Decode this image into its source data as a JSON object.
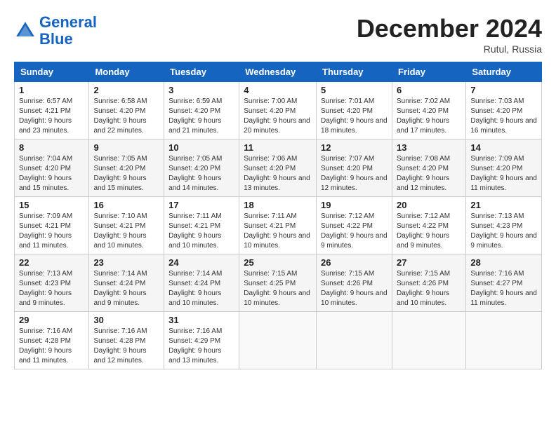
{
  "header": {
    "logo_line1": "General",
    "logo_line2": "Blue",
    "month": "December 2024",
    "location": "Rutul, Russia"
  },
  "weekdays": [
    "Sunday",
    "Monday",
    "Tuesday",
    "Wednesday",
    "Thursday",
    "Friday",
    "Saturday"
  ],
  "weeks": [
    [
      {
        "day": "1",
        "sunrise": "Sunrise: 6:57 AM",
        "sunset": "Sunset: 4:21 PM",
        "daylight": "Daylight: 9 hours and 23 minutes."
      },
      {
        "day": "2",
        "sunrise": "Sunrise: 6:58 AM",
        "sunset": "Sunset: 4:20 PM",
        "daylight": "Daylight: 9 hours and 22 minutes."
      },
      {
        "day": "3",
        "sunrise": "Sunrise: 6:59 AM",
        "sunset": "Sunset: 4:20 PM",
        "daylight": "Daylight: 9 hours and 21 minutes."
      },
      {
        "day": "4",
        "sunrise": "Sunrise: 7:00 AM",
        "sunset": "Sunset: 4:20 PM",
        "daylight": "Daylight: 9 hours and 20 minutes."
      },
      {
        "day": "5",
        "sunrise": "Sunrise: 7:01 AM",
        "sunset": "Sunset: 4:20 PM",
        "daylight": "Daylight: 9 hours and 18 minutes."
      },
      {
        "day": "6",
        "sunrise": "Sunrise: 7:02 AM",
        "sunset": "Sunset: 4:20 PM",
        "daylight": "Daylight: 9 hours and 17 minutes."
      },
      {
        "day": "7",
        "sunrise": "Sunrise: 7:03 AM",
        "sunset": "Sunset: 4:20 PM",
        "daylight": "Daylight: 9 hours and 16 minutes."
      }
    ],
    [
      {
        "day": "8",
        "sunrise": "Sunrise: 7:04 AM",
        "sunset": "Sunset: 4:20 PM",
        "daylight": "Daylight: 9 hours and 15 minutes."
      },
      {
        "day": "9",
        "sunrise": "Sunrise: 7:05 AM",
        "sunset": "Sunset: 4:20 PM",
        "daylight": "Daylight: 9 hours and 15 minutes."
      },
      {
        "day": "10",
        "sunrise": "Sunrise: 7:05 AM",
        "sunset": "Sunset: 4:20 PM",
        "daylight": "Daylight: 9 hours and 14 minutes."
      },
      {
        "day": "11",
        "sunrise": "Sunrise: 7:06 AM",
        "sunset": "Sunset: 4:20 PM",
        "daylight": "Daylight: 9 hours and 13 minutes."
      },
      {
        "day": "12",
        "sunrise": "Sunrise: 7:07 AM",
        "sunset": "Sunset: 4:20 PM",
        "daylight": "Daylight: 9 hours and 12 minutes."
      },
      {
        "day": "13",
        "sunrise": "Sunrise: 7:08 AM",
        "sunset": "Sunset: 4:20 PM",
        "daylight": "Daylight: 9 hours and 12 minutes."
      },
      {
        "day": "14",
        "sunrise": "Sunrise: 7:09 AM",
        "sunset": "Sunset: 4:20 PM",
        "daylight": "Daylight: 9 hours and 11 minutes."
      }
    ],
    [
      {
        "day": "15",
        "sunrise": "Sunrise: 7:09 AM",
        "sunset": "Sunset: 4:21 PM",
        "daylight": "Daylight: 9 hours and 11 minutes."
      },
      {
        "day": "16",
        "sunrise": "Sunrise: 7:10 AM",
        "sunset": "Sunset: 4:21 PM",
        "daylight": "Daylight: 9 hours and 10 minutes."
      },
      {
        "day": "17",
        "sunrise": "Sunrise: 7:11 AM",
        "sunset": "Sunset: 4:21 PM",
        "daylight": "Daylight: 9 hours and 10 minutes."
      },
      {
        "day": "18",
        "sunrise": "Sunrise: 7:11 AM",
        "sunset": "Sunset: 4:21 PM",
        "daylight": "Daylight: 9 hours and 10 minutes."
      },
      {
        "day": "19",
        "sunrise": "Sunrise: 7:12 AM",
        "sunset": "Sunset: 4:22 PM",
        "daylight": "Daylight: 9 hours and 9 minutes."
      },
      {
        "day": "20",
        "sunrise": "Sunrise: 7:12 AM",
        "sunset": "Sunset: 4:22 PM",
        "daylight": "Daylight: 9 hours and 9 minutes."
      },
      {
        "day": "21",
        "sunrise": "Sunrise: 7:13 AM",
        "sunset": "Sunset: 4:23 PM",
        "daylight": "Daylight: 9 hours and 9 minutes."
      }
    ],
    [
      {
        "day": "22",
        "sunrise": "Sunrise: 7:13 AM",
        "sunset": "Sunset: 4:23 PM",
        "daylight": "Daylight: 9 hours and 9 minutes."
      },
      {
        "day": "23",
        "sunrise": "Sunrise: 7:14 AM",
        "sunset": "Sunset: 4:24 PM",
        "daylight": "Daylight: 9 hours and 9 minutes."
      },
      {
        "day": "24",
        "sunrise": "Sunrise: 7:14 AM",
        "sunset": "Sunset: 4:24 PM",
        "daylight": "Daylight: 9 hours and 10 minutes."
      },
      {
        "day": "25",
        "sunrise": "Sunrise: 7:15 AM",
        "sunset": "Sunset: 4:25 PM",
        "daylight": "Daylight: 9 hours and 10 minutes."
      },
      {
        "day": "26",
        "sunrise": "Sunrise: 7:15 AM",
        "sunset": "Sunset: 4:26 PM",
        "daylight": "Daylight: 9 hours and 10 minutes."
      },
      {
        "day": "27",
        "sunrise": "Sunrise: 7:15 AM",
        "sunset": "Sunset: 4:26 PM",
        "daylight": "Daylight: 9 hours and 10 minutes."
      },
      {
        "day": "28",
        "sunrise": "Sunrise: 7:16 AM",
        "sunset": "Sunset: 4:27 PM",
        "daylight": "Daylight: 9 hours and 11 minutes."
      }
    ],
    [
      {
        "day": "29",
        "sunrise": "Sunrise: 7:16 AM",
        "sunset": "Sunset: 4:28 PM",
        "daylight": "Daylight: 9 hours and 11 minutes."
      },
      {
        "day": "30",
        "sunrise": "Sunrise: 7:16 AM",
        "sunset": "Sunset: 4:28 PM",
        "daylight": "Daylight: 9 hours and 12 minutes."
      },
      {
        "day": "31",
        "sunrise": "Sunrise: 7:16 AM",
        "sunset": "Sunset: 4:29 PM",
        "daylight": "Daylight: 9 hours and 13 minutes."
      },
      null,
      null,
      null,
      null
    ]
  ]
}
